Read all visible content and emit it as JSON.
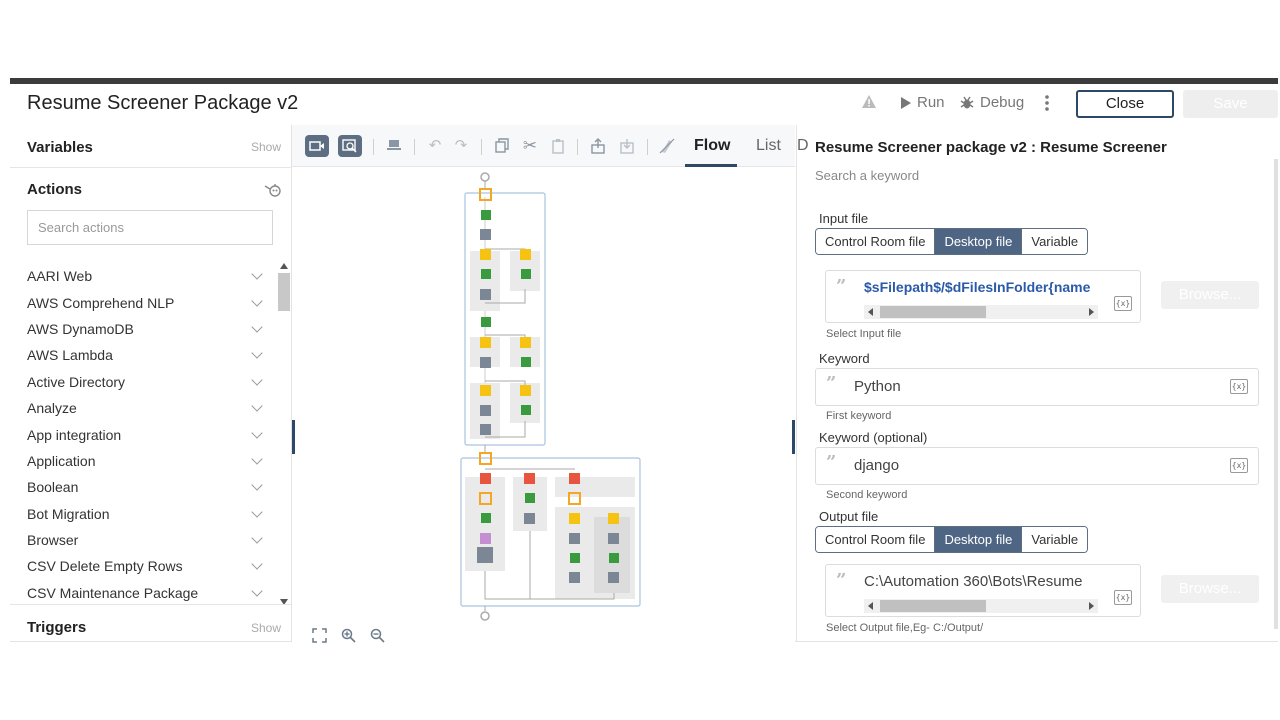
{
  "header": {
    "title": "Resume Screener Package v2",
    "run_label": "Run",
    "debug_label": "Debug",
    "close_label": "Close",
    "save_label": "Save"
  },
  "left_panel": {
    "variables_title": "Variables",
    "variables_show": "Show",
    "actions_title": "Actions",
    "search_placeholder": "Search actions",
    "actions": [
      "AARI Web",
      "AWS Comprehend NLP",
      "AWS DynamoDB",
      "AWS Lambda",
      "Active Directory",
      "Analyze",
      "App integration",
      "Application",
      "Boolean",
      "Bot Migration",
      "Browser",
      "CSV Delete Empty Rows",
      "CSV Maintenance Package"
    ],
    "triggers_title": "Triggers",
    "triggers_show": "Show"
  },
  "canvas": {
    "tabs": [
      "Flow",
      "List",
      "D"
    ],
    "active_tab": "Flow"
  },
  "right_panel": {
    "title": "Resume Screener package v2 : Resume Screener",
    "search_keyword": "Search a keyword",
    "input_file": {
      "label": "Input file",
      "options": [
        "Control Room file",
        "Desktop file",
        "Variable"
      ],
      "selected": "Desktop file",
      "value": "$sFilepath$/$dFilesInFolder{name",
      "browse_label": "Browse...",
      "help": "Select Input file"
    },
    "keyword": {
      "label": "Keyword",
      "value": "Python",
      "help": "First keyword"
    },
    "keyword_optional": {
      "label": "Keyword (optional)",
      "value": "django",
      "help": "Second keyword"
    },
    "output_file": {
      "label": "Output file",
      "options": [
        "Control Room file",
        "Desktop file",
        "Variable"
      ],
      "selected": "Desktop file",
      "value": "C:\\Automation 360\\Bots\\Resume",
      "browse_label": "Browse...",
      "help": "Select Output file,Eg- C:/Output/"
    },
    "var_icon_text": "{x}"
  },
  "colors": {
    "accent": "#2e4868",
    "selected_seg": "#4e6684",
    "node_orange": "#f5a623",
    "node_green": "#3a9a3e",
    "node_yellow": "#f6c312",
    "node_red": "#e8553f",
    "node_gray": "#7b8794",
    "node_purple": "#c48fd0",
    "variable_text": "#2a5aa8"
  }
}
